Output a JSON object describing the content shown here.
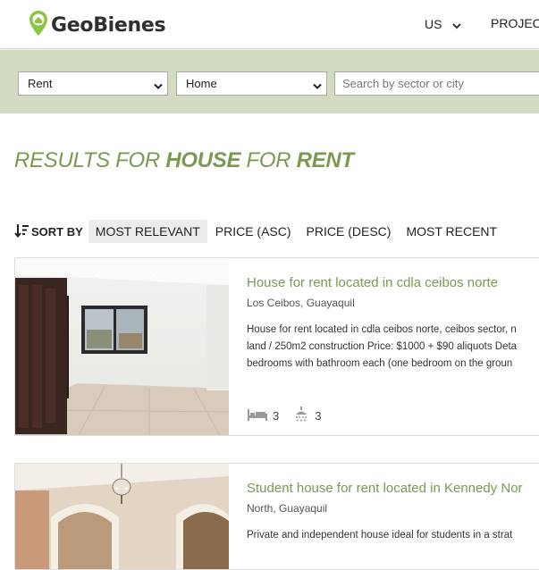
{
  "header": {
    "logo_text": "GeoBienes",
    "nav_us": "US",
    "nav_projects": "PROJECT"
  },
  "search": {
    "operation": "Rent",
    "property_type": "Home",
    "placeholder": "Search by sector or city"
  },
  "results": {
    "prefix": "RESULTS FOR ",
    "type": "HOUSE",
    "middle": " FOR ",
    "operation": "RENT"
  },
  "sort": {
    "label": "SORT BY",
    "options": [
      "MOST RELEVANT",
      "PRICE (ASC)",
      "PRICE (DESC)",
      "MOST RECENT"
    ],
    "active": "MOST RELEVANT"
  },
  "listings": [
    {
      "title": "House for rent located in cdla ceibos norte",
      "location": "Los Ceibos, Guayaquil",
      "description_lines": [
        "House for rent located in cdla ceibos norte, ceibos sector, n",
        "land / 250m2 construction Price: $1000 + $90 aliquots Deta",
        "bedrooms with bathroom each (one bedroom on the groun"
      ],
      "bedrooms": "3",
      "bathrooms": "3"
    },
    {
      "title": "Student house for rent located in Kennedy Nor",
      "location": "North, Guayaquil",
      "description_lines": [
        "Private and independent house ideal for students in a strat"
      ]
    }
  ],
  "colors": {
    "brand_green": "#7a9a52",
    "search_band": "#d3dcc2",
    "logo_pin": "#8cc63f"
  }
}
